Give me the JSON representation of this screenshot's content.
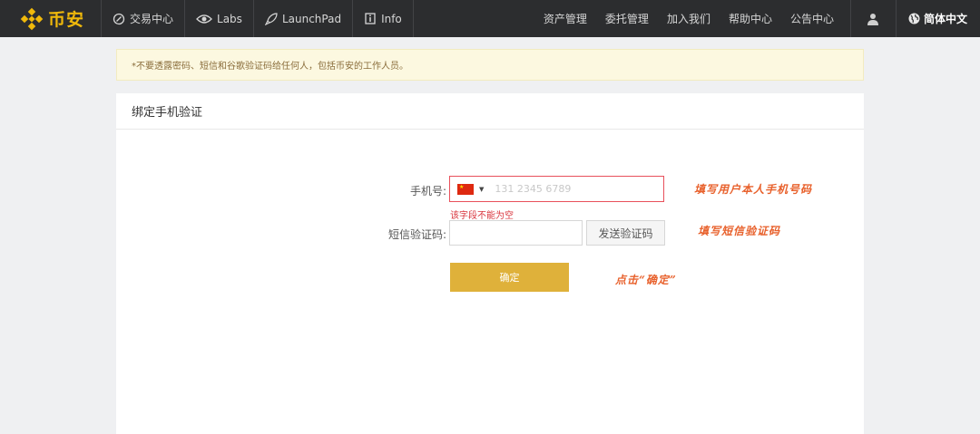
{
  "nav": {
    "logo_text": "币安",
    "items": [
      {
        "label": "交易中心",
        "icon": "exchange-icon"
      },
      {
        "label": "Labs",
        "icon": "eye-icon"
      },
      {
        "label": "LaunchPad",
        "icon": "rocket-icon"
      },
      {
        "label": "Info",
        "icon": "info-icon"
      }
    ],
    "right_links": [
      "资产管理",
      "委托管理",
      "加入我们",
      "帮助中心",
      "公告中心"
    ],
    "language": "简体中文"
  },
  "warning": "*不要透露密码、短信和谷歌验证码给任何人，包括币安的工作人员。",
  "card": {
    "title": "绑定手机验证",
    "phone_label": "手机号:",
    "phone_placeholder": "131 2345 6789",
    "phone_error": "该字段不能为空",
    "sms_label": "短信验证码:",
    "sms_button": "发送验证码",
    "confirm_button": "确定"
  },
  "annotations": {
    "phone": "填写用户本人手机号码",
    "sms": "填写短信验证码",
    "confirm": "点击“确定”"
  },
  "colors": {
    "brand": "#f0b90b",
    "nav_bg": "#2c2d2f",
    "confirm": "#dfb13a",
    "error": "#d9363e",
    "annotation": "#e8612c"
  }
}
